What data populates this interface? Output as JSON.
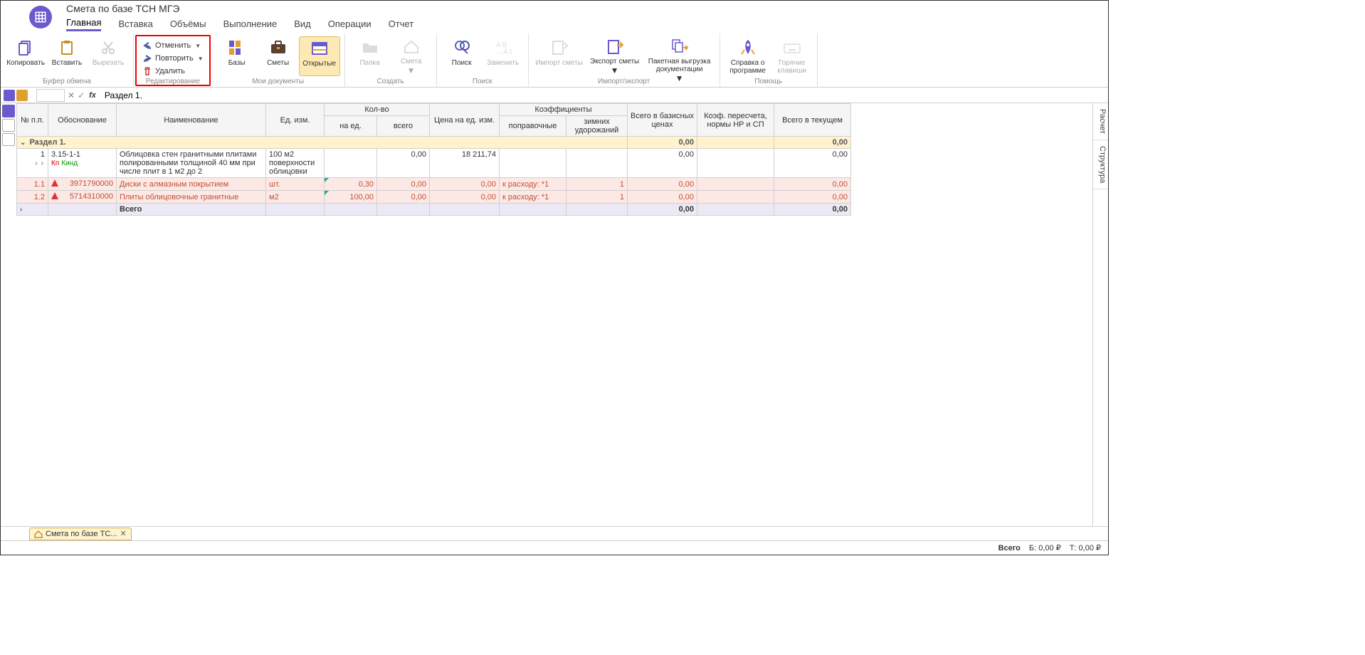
{
  "window": {
    "title": "Смета по базе ТСН МГЭ"
  },
  "tabs": [
    "Главная",
    "Вставка",
    "Объёмы",
    "Выполнение",
    "Вид",
    "Операции",
    "Отчет"
  ],
  "ribbon": {
    "clipboard": {
      "group": "Буфер обмена",
      "copy": "Копировать",
      "paste": "Вставить",
      "cut": "Вырезать"
    },
    "edit": {
      "group": "Редактирование",
      "undo": "Отменить",
      "redo": "Повторить",
      "delete": "Удалить"
    },
    "docs": {
      "group": "Мои документы",
      "bases": "Базы",
      "estimates": "Сметы",
      "open": "Открытые"
    },
    "create": {
      "group": "Создать",
      "folder": "Папка",
      "estimate": "Смета"
    },
    "search": {
      "group": "Поиск",
      "search": "Поиск",
      "replace": "Заменить"
    },
    "impexp": {
      "group": "Импорт/экспорт",
      "import": "Импорт сметы",
      "export": "Экспорт сметы",
      "batch": "Пакетная выгрузка документации"
    },
    "help": {
      "group": "Помощь",
      "about": "Справка о программе",
      "hotkeys": "Горячие клавиши"
    }
  },
  "formula": {
    "value": "Раздел 1."
  },
  "columns": {
    "num": "№ п.п.",
    "basis": "Обоснование",
    "name": "Наименование",
    "unit": "Ед. изм.",
    "qty": "Кол-во",
    "qty_per": "на ед.",
    "qty_total": "всего",
    "price": "Цена на ед. изм.",
    "coef": "Коэффициенты",
    "coef_corr": "поправочные",
    "coef_winter": "зимних удорожаний",
    "base": "Всего в базисных ценах",
    "recalc": "Коэф. пересчета, нормы НР и СП",
    "current": "Всего в текущем"
  },
  "rows": {
    "section": {
      "title": "Раздел 1.",
      "base": "0,00",
      "current": "0,00"
    },
    "r1": {
      "num": "1",
      "code": "3.15-1-1",
      "name": "Облицовка стен гранитными плитами полированными толщиной 40 мм при числе плит в 1 м2 до 2",
      "unit": "100 м2 поверхности облицовки",
      "qty_total": "0,00",
      "price": "18 211,74",
      "base": "0,00",
      "current": "0,00",
      "kp": "Кп",
      "kind": "Кинд"
    },
    "r11": {
      "num": "1.1",
      "code": "3971790000",
      "name": "Диски с алмазным покрытием",
      "unit": "шт.",
      "qty_per": "0,30",
      "qty_total": "0,00",
      "price": "0,00",
      "coef_corr": "к расходу: *1",
      "coef_winter": "1",
      "base": "0,00",
      "current": "0,00"
    },
    "r12": {
      "num": "1.2",
      "code": "5714310000",
      "name": "Плиты облицовочные гранитные",
      "unit": "м2",
      "qty_per": "100,00",
      "qty_total": "0,00",
      "price": "0,00",
      "coef_corr": "к расходу: *1",
      "coef_winter": "1",
      "base": "0,00",
      "current": "0,00"
    },
    "total": {
      "name": "Всего",
      "base": "0,00",
      "current": "0,00"
    }
  },
  "rightTabs": [
    "Расчет",
    "Структура"
  ],
  "docTab": "Смета по базе ТС...",
  "status": {
    "label": "Всего",
    "base": "Б: 0,00 ₽",
    "current": "Т: 0,00 ₽"
  }
}
